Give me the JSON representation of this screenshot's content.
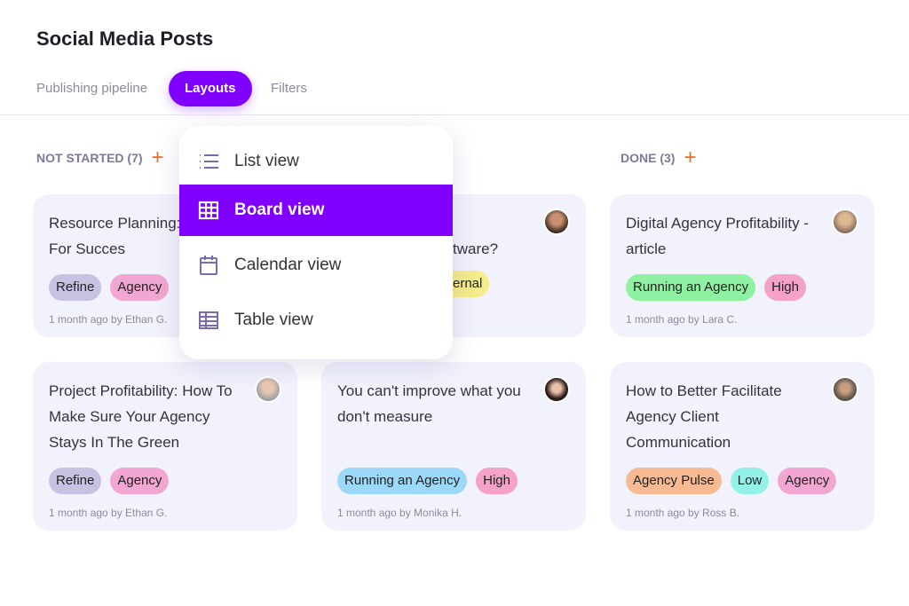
{
  "header": {
    "title": "Social Media Posts"
  },
  "tabs": [
    {
      "label": "Publishing pipeline"
    },
    {
      "label": "Layouts",
      "active": true
    },
    {
      "label": "Filters"
    }
  ],
  "columns": [
    {
      "label": "NOT STARTED (7)",
      "add": "+"
    },
    {
      "label": "DONE (3)",
      "add": "+"
    }
  ],
  "cards": [
    {
      "title": "Resource Planning: Prepare For Succes",
      "tags": [
        "Refine",
        "Agency"
      ],
      "meta": "1 month ago by Ethan G."
    },
    {
      "title": "tware?",
      "tags": [
        "ernal"
      ],
      "meta": ""
    },
    {
      "title": "Digital Agency Profitability - article",
      "tags": [
        "Running an Agency",
        "High"
      ],
      "meta": "1 month ago by Lara C."
    },
    {
      "title": "Project Profitability: How To Make Sure Your Agency Stays In The Green",
      "tags": [
        "Refine",
        "Agency"
      ],
      "meta": "1 month ago by Ethan G."
    },
    {
      "title": "You can't improve what you don't measure",
      "tags": [
        "Running an Agency",
        "High"
      ],
      "meta": "1 month ago by Monika H."
    },
    {
      "title": "How to Better Facilitate Agency Client Communication",
      "tags": [
        "Agency Pulse",
        "Low",
        "Agency"
      ],
      "meta": "1 month ago by Ross B."
    }
  ],
  "menu": {
    "items": [
      {
        "label": "List view",
        "icon": "list-icon"
      },
      {
        "label": "Board view",
        "icon": "grid-icon",
        "selected": true
      },
      {
        "label": "Calendar view",
        "icon": "calendar-icon"
      },
      {
        "label": "Table view",
        "icon": "table-icon"
      }
    ]
  },
  "colors": {
    "accent": "#8000ff",
    "plus": "#f06a20",
    "refine": "#c8c2e2",
    "agency": "#f2a6d2",
    "running_green": "#8ef2a2",
    "high": "#f5a2c8",
    "running_blue": "#9cd8fa",
    "pulse": "#f8ba92",
    "low": "#92f2e8",
    "internal": "#f5ec8a"
  }
}
